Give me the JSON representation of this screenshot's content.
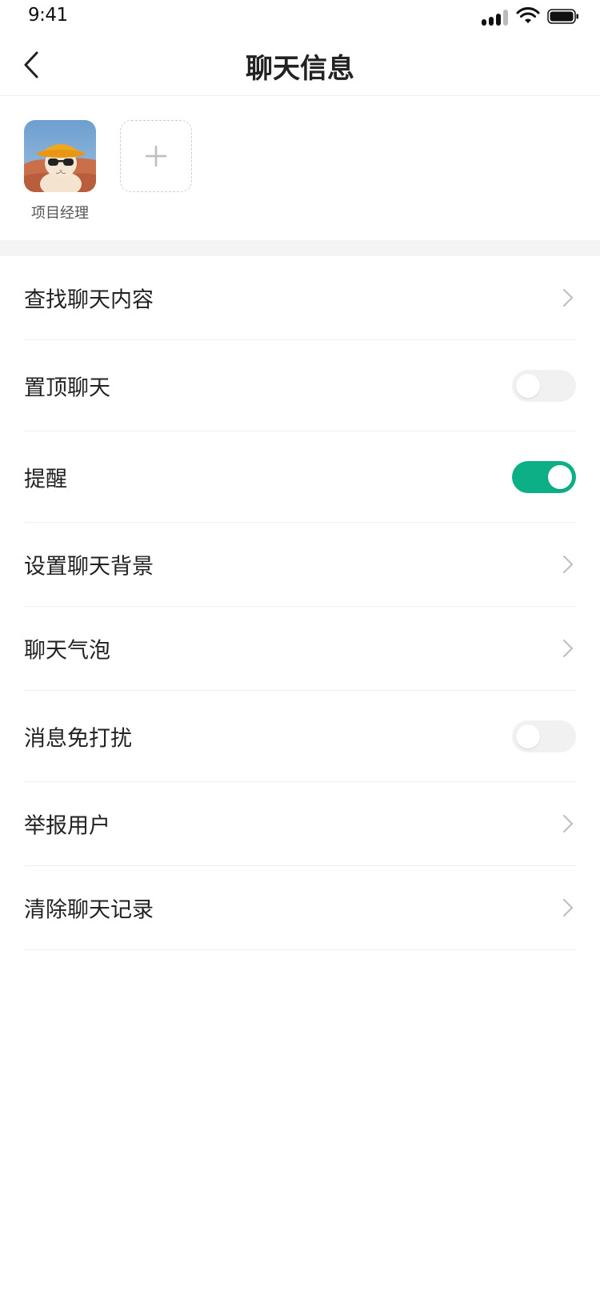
{
  "status_bar": {
    "time": "9:41"
  },
  "nav": {
    "title": "聊天信息"
  },
  "members": [
    {
      "name": "项目经理"
    }
  ],
  "settings": {
    "search_chat": "查找聊天内容",
    "pin_chat": {
      "label": "置顶聊天",
      "on": false
    },
    "remind": {
      "label": "提醒",
      "on": true
    },
    "chat_background": "设置聊天背景",
    "chat_bubble": "聊天气泡",
    "do_not_disturb": {
      "label": "消息免打扰",
      "on": false
    },
    "report_user": "举报用户",
    "clear_history": "清除聊天记录"
  },
  "colors": {
    "accent": "#0db086",
    "toggle_off": "#f1f1f1"
  },
  "icons": [
    "back-arrow-icon",
    "plus-icon",
    "chevron-right-icon",
    "signal-icon",
    "wifi-icon",
    "battery-icon"
  ]
}
